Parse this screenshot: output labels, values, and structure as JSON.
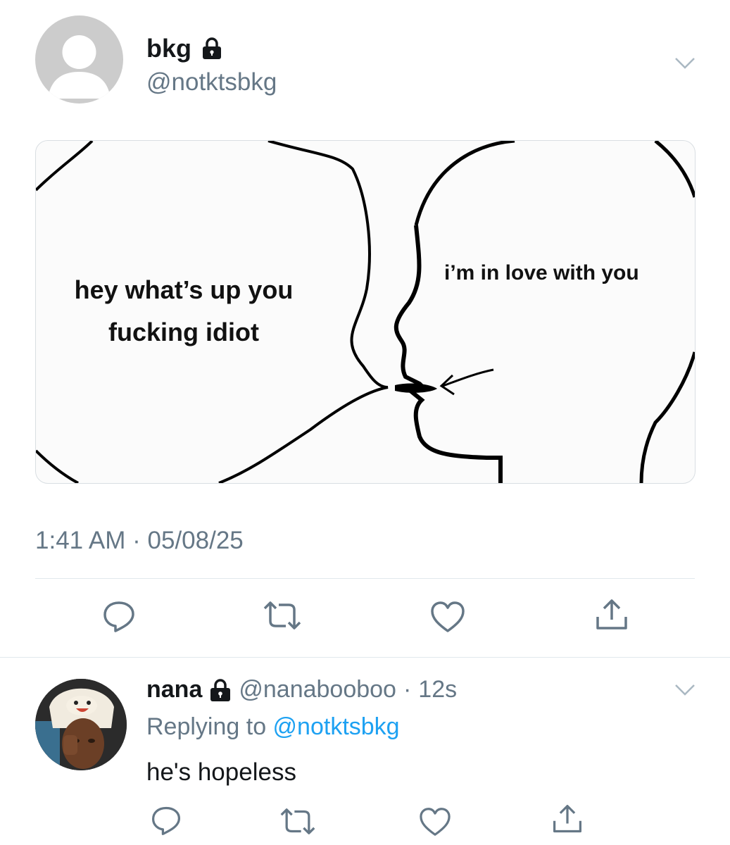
{
  "tweet": {
    "display_name": "bkg",
    "handle": "@notktsbkg",
    "locked": true,
    "image": {
      "left_bubble_text": [
        "hey what’s up you",
        "fucking idiot"
      ],
      "right_bubble_text": "i’m in love with you"
    },
    "timestamp": "1:41 AM · 05/08/25"
  },
  "actions": [
    "reply-icon",
    "retweet-icon",
    "like-icon",
    "share-icon"
  ],
  "reply": {
    "display_name": "nana",
    "handle": "@nanabooboo",
    "separator": "·",
    "age": "12s",
    "replying_prefix": "Replying to ",
    "replying_handle": "@notktsbkg",
    "text": "he's hopeless"
  },
  "colors": {
    "text": "#14171a",
    "secondary": "#657786",
    "link": "#1da1f2",
    "divider": "#e1e8ed"
  }
}
